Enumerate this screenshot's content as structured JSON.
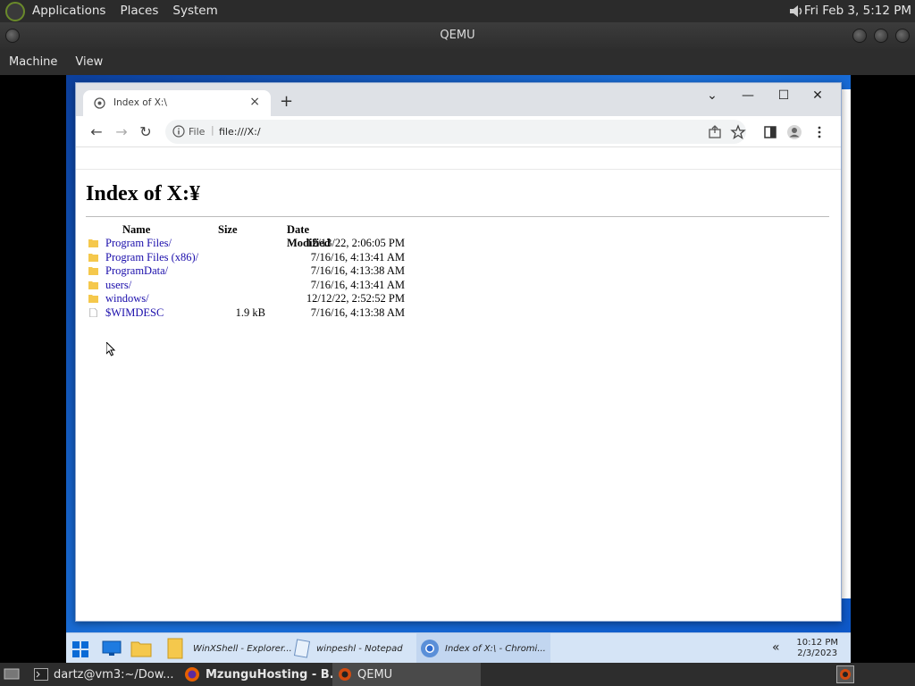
{
  "host_panel": {
    "menus": [
      "Applications",
      "Places",
      "System"
    ],
    "clock": "Fri Feb  3,  5:12 PM"
  },
  "qemu": {
    "title": "QEMU",
    "menus": [
      "Machine",
      "View"
    ]
  },
  "browser": {
    "tab_title": "Index of X:\\",
    "tab_close": "×",
    "new_tab": "+",
    "window_controls": {
      "dropdown": "⌄",
      "minimize": "—",
      "maximize": "☐",
      "close": "✕"
    },
    "nav": {
      "back": "←",
      "forward": "→",
      "reload": "↻"
    },
    "omnibox": {
      "scheme": "File",
      "separator": "|",
      "url": "file:///X:/"
    }
  },
  "page": {
    "heading": "Index of X:¥",
    "columns": {
      "name": "Name",
      "size": "Size",
      "date": "Date Modified"
    },
    "entries": [
      {
        "name": "Program Files/",
        "size": "",
        "date": "12/13/22, 2:06:05 PM",
        "type": "folder"
      },
      {
        "name": "Program Files (x86)/",
        "size": "",
        "date": "7/16/16, 4:13:41 AM",
        "type": "folder"
      },
      {
        "name": "ProgramData/",
        "size": "",
        "date": "7/16/16, 4:13:38 AM",
        "type": "folder"
      },
      {
        "name": "users/",
        "size": "",
        "date": "7/16/16, 4:13:41 AM",
        "type": "folder"
      },
      {
        "name": "windows/",
        "size": "",
        "date": "12/12/22, 2:52:52 PM",
        "type": "folder"
      },
      {
        "name": "$WIMDESC",
        "size": "1.9 kB",
        "date": "7/16/16, 4:13:38 AM",
        "type": "file"
      }
    ]
  },
  "taskbar": {
    "items": [
      {
        "label": "WinXShell - Explorer..."
      },
      {
        "label": "winpeshl - Notepad"
      },
      {
        "label": "Index of X:\\ - Chromi..."
      }
    ],
    "chevron": "«",
    "time": "10:12 PM",
    "date": "2/3/2023"
  },
  "host_bottom": {
    "items": [
      {
        "label": "dartz@vm3:~/Dow..."
      },
      {
        "label": "MzunguHosting - B..."
      },
      {
        "label": "QEMU"
      }
    ]
  },
  "colors": {
    "link": "#1a0dab",
    "tabstrip": "#dee1e6",
    "taskbar": "#d5e4f6",
    "desktop": "#1a6fd8"
  }
}
